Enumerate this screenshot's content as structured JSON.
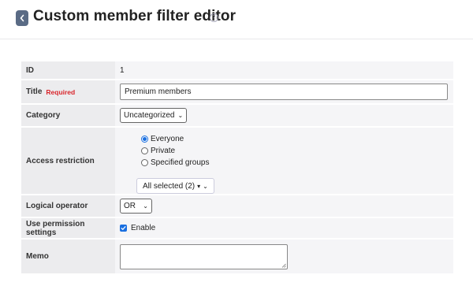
{
  "header": {
    "title": "Custom member filter editor",
    "back_icon": "chevron-left-icon",
    "help_icon": "question-circle-icon",
    "help_glyph": "?"
  },
  "form": {
    "id": {
      "label": "ID",
      "value": "1"
    },
    "title": {
      "label": "Title",
      "required": "Required",
      "value": "Premium members"
    },
    "category": {
      "label": "Category",
      "selected": "Uncategorized"
    },
    "access": {
      "label": "Access restriction",
      "options": [
        "Everyone",
        "Private",
        "Specified groups"
      ],
      "selected": "Everyone",
      "groups_dropdown": "All selected (2)"
    },
    "logic": {
      "label": "Logical operator",
      "selected": "OR"
    },
    "permission": {
      "label": "Use permission settings",
      "checkbox_label": "Enable",
      "checked": true
    },
    "memo": {
      "label": "Memo",
      "value": ""
    }
  },
  "colors": {
    "accent": "#1a6fe0",
    "required": "#d9262c",
    "back_button": "#5a6b85",
    "label_bg": "#ececee",
    "value_bg": "#f5f5f7"
  }
}
